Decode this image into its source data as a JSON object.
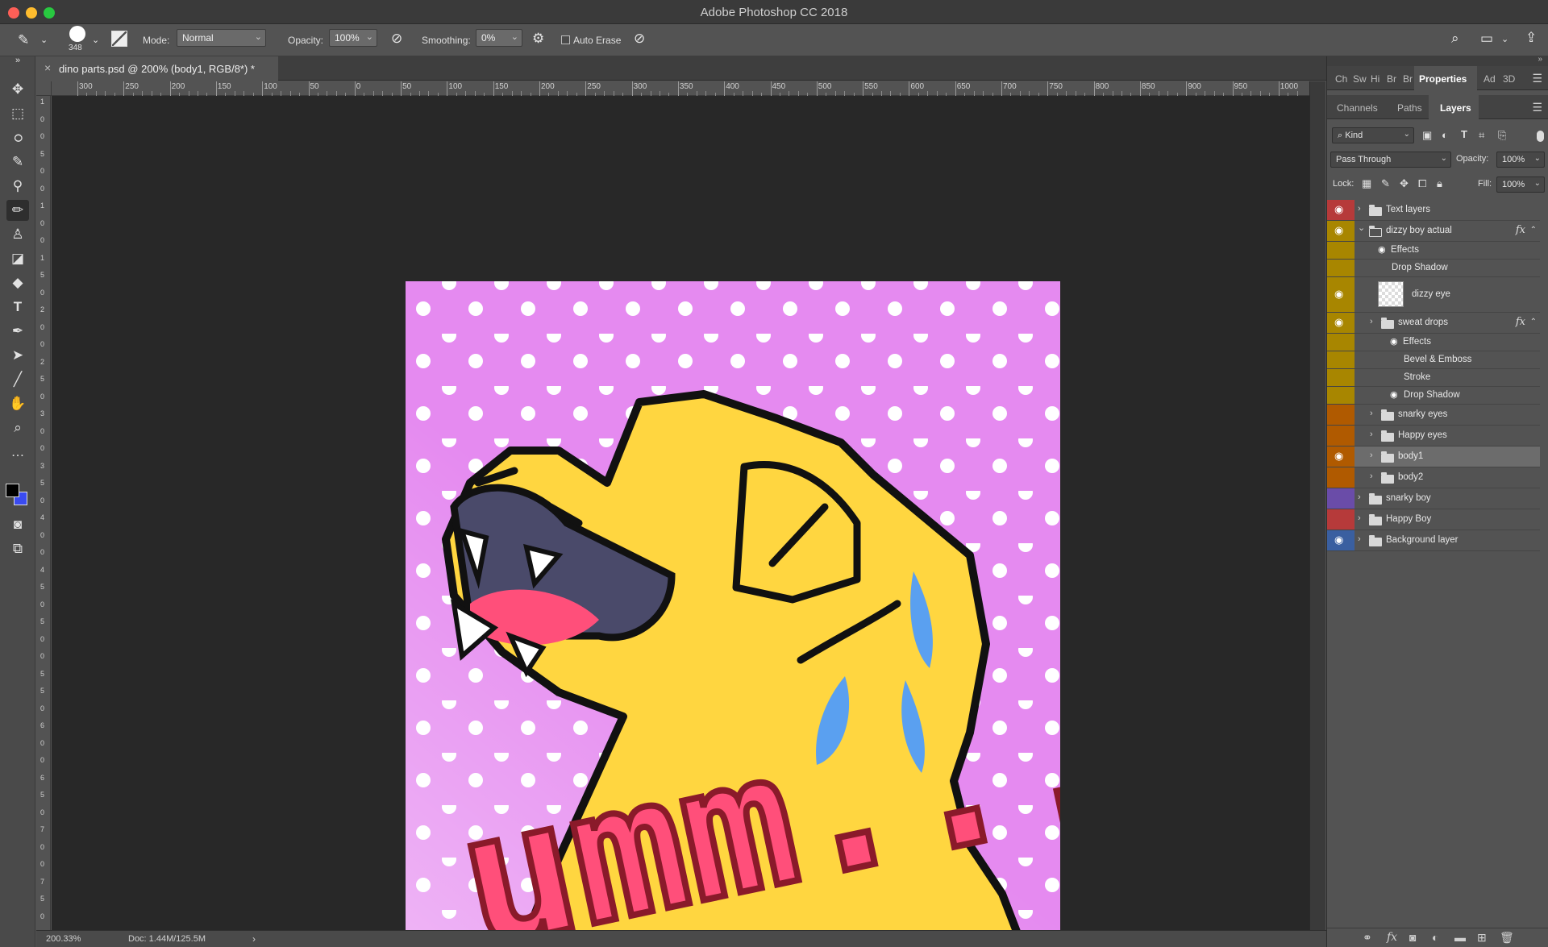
{
  "app": {
    "title": "Adobe Photoshop CC 2018"
  },
  "options": {
    "brush_size": "348",
    "mode_label": "Mode:",
    "mode_value": "Normal",
    "opacity_label": "Opacity:",
    "opacity_value": "100%",
    "smoothing_label": "Smoothing:",
    "smoothing_value": "0%",
    "auto_erase_label": "Auto Erase"
  },
  "document": {
    "tab_title": "dino parts.psd @ 200% (body1, RGB/8*) *",
    "zoom": "200.33%",
    "doc_size": "Doc: 1.44M/125.5M"
  },
  "rulers": {
    "horizontal": [
      "300",
      "250",
      "200",
      "150",
      "100",
      "50",
      "0",
      "50",
      "100",
      "150",
      "200",
      "250",
      "300",
      "350",
      "400",
      "450",
      "500",
      "550",
      "600",
      "650",
      "700",
      "750",
      "800",
      "850",
      "900",
      "950",
      "1000"
    ],
    "vertical": [
      "1",
      "0",
      "0",
      "5",
      "0",
      "0",
      "1",
      "0",
      "0",
      "1",
      "5",
      "0",
      "2",
      "0",
      "0",
      "2",
      "5",
      "0",
      "3",
      "0",
      "0",
      "3",
      "5",
      "0",
      "4",
      "0",
      "0",
      "4",
      "5",
      "0",
      "5",
      "0",
      "0",
      "5",
      "5",
      "0",
      "6",
      "0",
      "0",
      "6",
      "5",
      "0",
      "7",
      "0",
      "0",
      "7",
      "5",
      "0"
    ]
  },
  "artwork": {
    "caption": "umm...",
    "bg_color": "#e58af0",
    "dino_color": "#ffd640"
  },
  "panels": {
    "top_tabs": [
      "Ch",
      "Sw",
      "Hi",
      "Br",
      "Br",
      "Properties",
      "Ad",
      "3D"
    ],
    "top_tabs_active": "Properties",
    "layer_tabs": [
      "Channels",
      "Paths",
      "Layers"
    ],
    "layer_tabs_active": "Layers",
    "filter_kind": "Kind",
    "blend_mode": "Pass Through",
    "opacity_label": "Opacity:",
    "opacity_value": "100%",
    "lock_label": "Lock:",
    "fill_label": "Fill:",
    "fill_value": "100%"
  },
  "layers": [
    {
      "name": "Text layers",
      "visible": true,
      "color": "#b63a3a",
      "indent": 0,
      "type": "group",
      "open": false
    },
    {
      "name": "dizzy boy actual",
      "visible": true,
      "color": "#a88600",
      "indent": 0,
      "type": "group",
      "open": true,
      "fx": "fx"
    },
    {
      "name": "Effects",
      "visible": true,
      "color": "#a88600",
      "indent": 1,
      "type": "effects"
    },
    {
      "name": "Drop Shadow",
      "visible": false,
      "color": "#a88600",
      "indent": 2,
      "type": "effect"
    },
    {
      "name": "dizzy eye",
      "visible": true,
      "color": "#a88600",
      "indent": 1,
      "type": "pixel"
    },
    {
      "name": "sweat drops",
      "visible": true,
      "color": "#a88600",
      "indent": 1,
      "type": "group",
      "open": false,
      "fx": "fx"
    },
    {
      "name": "Effects",
      "visible": true,
      "color": "#a88600",
      "indent": 2,
      "type": "effects"
    },
    {
      "name": "Bevel & Emboss",
      "visible": false,
      "color": "#a88600",
      "indent": 3,
      "type": "effect"
    },
    {
      "name": "Stroke",
      "visible": false,
      "color": "#a88600",
      "indent": 3,
      "type": "effect"
    },
    {
      "name": "Drop Shadow",
      "visible": true,
      "color": "#a88600",
      "indent": 3,
      "type": "effect"
    },
    {
      "name": "snarky eyes",
      "visible": false,
      "color": "#b05a00",
      "indent": 1,
      "type": "group",
      "open": false
    },
    {
      "name": "Happy eyes",
      "visible": false,
      "color": "#b05a00",
      "indent": 1,
      "type": "group",
      "open": false
    },
    {
      "name": "body1",
      "visible": true,
      "color": "#b05a00",
      "indent": 1,
      "type": "group",
      "open": false,
      "selected": true
    },
    {
      "name": "body2",
      "visible": false,
      "color": "#b05a00",
      "indent": 1,
      "type": "group",
      "open": false
    },
    {
      "name": "snarky boy",
      "visible": false,
      "color": "#6a4ca8",
      "indent": 0,
      "type": "group",
      "open": false
    },
    {
      "name": "Happy Boy",
      "visible": false,
      "color": "#b63a3a",
      "indent": 0,
      "type": "group",
      "open": false
    },
    {
      "name": "Background layer",
      "visible": true,
      "color": "#3a5fa0",
      "indent": 0,
      "type": "group",
      "open": false
    }
  ]
}
